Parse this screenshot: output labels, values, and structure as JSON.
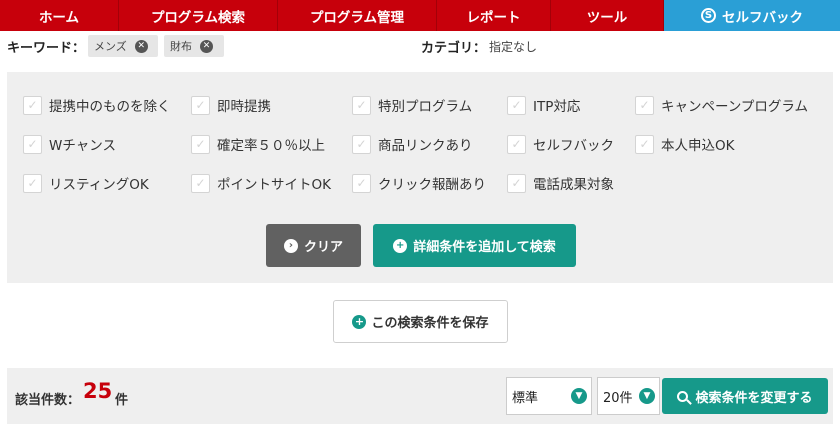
{
  "nav": {
    "items": [
      "ホーム",
      "プログラム検索",
      "プログラム管理",
      "レポート",
      "ツール"
    ],
    "selfback": "セルフバック",
    "selfback_icon": "S"
  },
  "keyword": {
    "label": "キーワード：",
    "tags": [
      "メンズ",
      "財布"
    ]
  },
  "category": {
    "label": "カテゴリ：",
    "value": "指定なし"
  },
  "filters": [
    "提携中のものを除く",
    "即時提携",
    "特別プログラム",
    "ITP対応",
    "キャンペーンプログラム",
    "Wチャンス",
    "確定率５０％以上",
    "商品リンクあり",
    "セルフバック",
    "本人申込OK",
    "リスティングOK",
    "ポイントサイトOK",
    "クリック報酬あり",
    "電話成果対象"
  ],
  "buttons": {
    "clear": "クリア",
    "detail": "詳細条件を追加して検索",
    "save": "この検索条件を保存",
    "change": "検索条件を変更する"
  },
  "results": {
    "label": "該当件数：",
    "count": "25",
    "unit": "件"
  },
  "selects": {
    "sort": "標準",
    "per_page": "20件"
  },
  "colors": {
    "nav_red": "#c7000b",
    "selfback_blue": "#2a9fd6",
    "accent_green": "#16998a",
    "clear_gray": "#616161"
  }
}
